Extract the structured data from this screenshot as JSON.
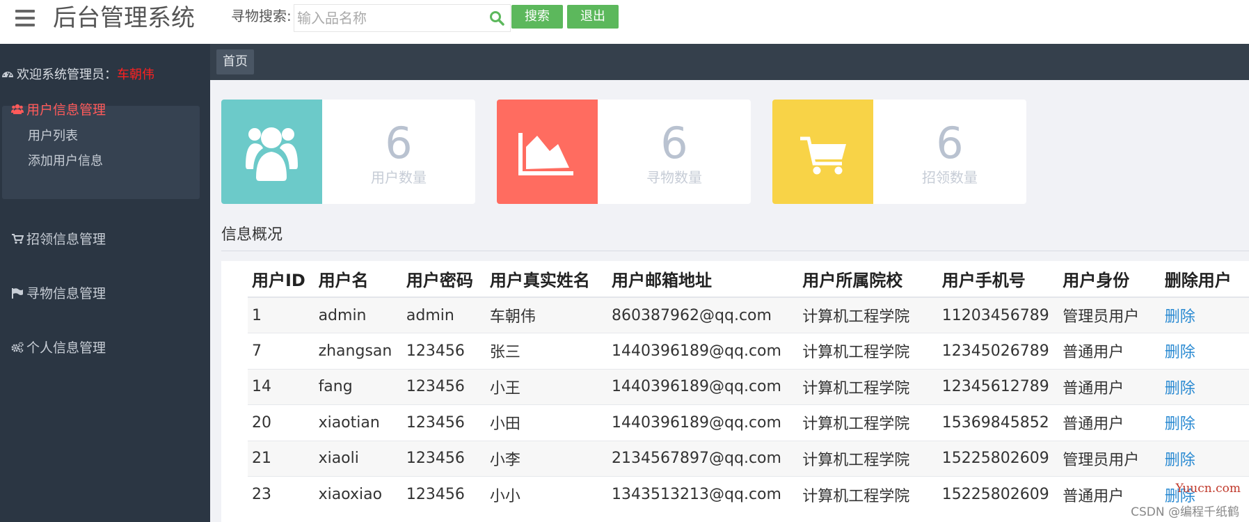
{
  "header": {
    "title": "后台管理系统",
    "search_label": "寻物搜索:",
    "search_placeholder": "输入品名称",
    "search_button": "搜索",
    "logout_button": "退出",
    "accent_color": "#5cb85c"
  },
  "sidebar": {
    "welcome_prefix": "欢迎系统管理员：",
    "admin_name": "车朝伟",
    "menus": [
      {
        "label": "用户信息管理",
        "icon": "users-icon",
        "active": true,
        "children": [
          "用户列表",
          "添加用户信息"
        ]
      },
      {
        "label": "招领信息管理",
        "icon": "cart-icon",
        "active": false
      },
      {
        "label": "寻物信息管理",
        "icon": "flag-icon",
        "active": false
      },
      {
        "label": "个人信息管理",
        "icon": "cogs-icon",
        "active": false
      }
    ]
  },
  "breadcrumb": {
    "home": "首页"
  },
  "stats": [
    {
      "value": "6",
      "label": "用户数量",
      "color": "#6ccac9",
      "icon": "users-icon"
    },
    {
      "value": "6",
      "label": "寻物数量",
      "color": "#ff6c60",
      "icon": "area-chart-icon"
    },
    {
      "value": "6",
      "label": "招领数量",
      "color": "#f8d347",
      "icon": "cart-icon"
    }
  ],
  "overview": {
    "title": "信息概况",
    "columns": [
      "用户ID",
      "用户名",
      "用户密码",
      "用户真实姓名",
      "用户邮箱地址",
      "用户所属院校",
      "用户手机号",
      "用户身份",
      "删除用户"
    ],
    "rows": [
      [
        "1",
        "admin",
        "admin",
        "车朝伟",
        "860387962@qq.com",
        "计算机工程学院",
        "11203456789",
        "管理员用户",
        "删除"
      ],
      [
        "7",
        "zhangsan",
        "123456",
        "张三",
        "1440396189@qq.com",
        "计算机工程学院",
        "12345026789",
        "普通用户",
        "删除"
      ],
      [
        "14",
        "fang",
        "123456",
        "小王",
        "1440396189@qq.com",
        "计算机工程学院",
        "12345612789",
        "普通用户",
        "删除"
      ],
      [
        "20",
        "xiaotian",
        "123456",
        "小田",
        "1440396189@qq.com",
        "计算机工程学院",
        "15369845852",
        "普通用户",
        "删除"
      ],
      [
        "21",
        "xiaoli",
        "123456",
        "小李",
        "2134567897@qq.com",
        "计算机工程学院",
        "15225802609",
        "管理员用户",
        "删除"
      ],
      [
        "23",
        "xiaoxiao",
        "123456",
        "小小",
        "1343513213@qq.com",
        "计算机工程学院",
        "15225802609",
        "普通用户",
        "删除"
      ]
    ]
  },
  "watermark": {
    "site": "Yuucn.com",
    "author": "CSDN @编程千纸鹤"
  }
}
